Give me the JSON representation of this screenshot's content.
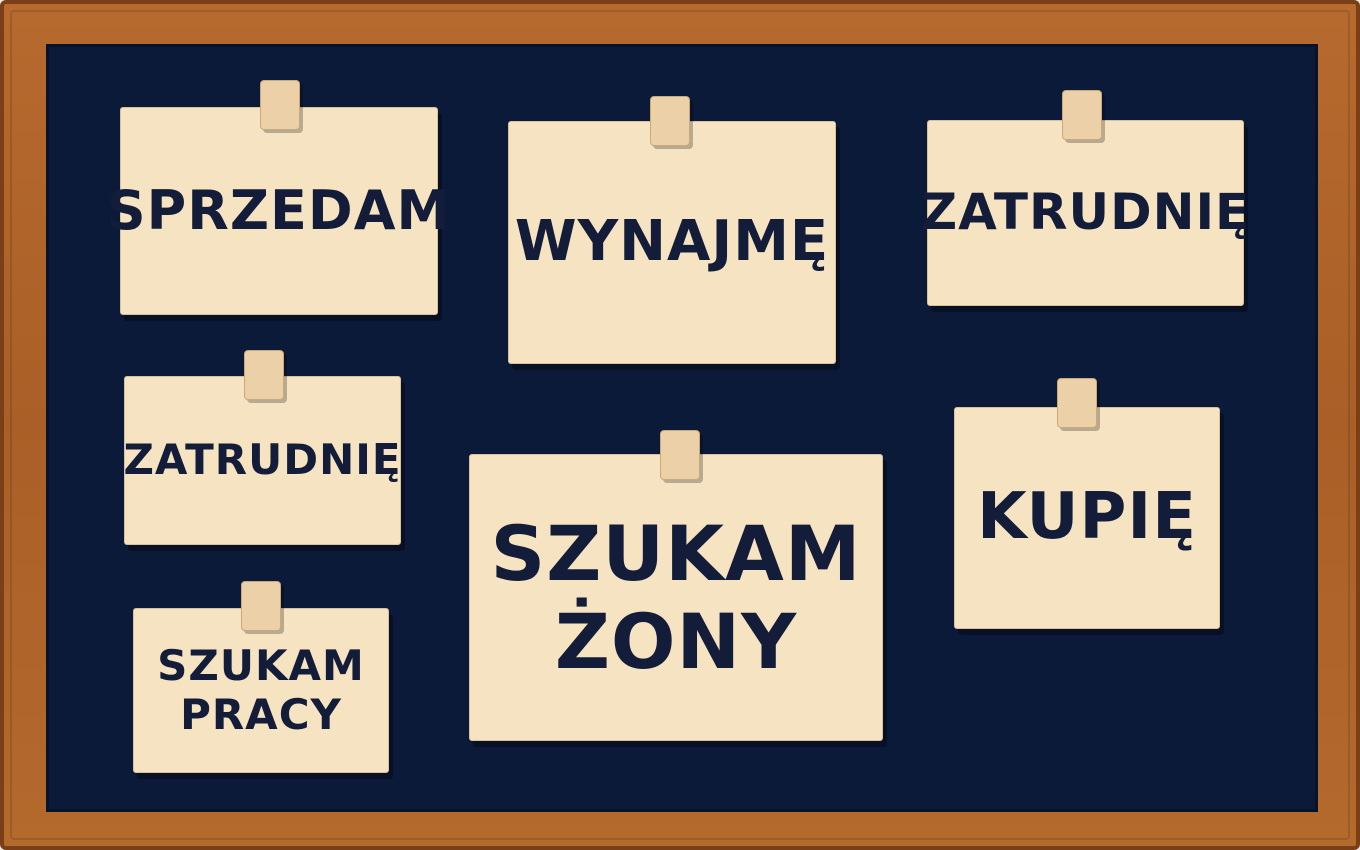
{
  "board": {
    "colors": {
      "frame": "#b06429",
      "surface": "#0c1a3a",
      "note": "#f5e3c2",
      "text": "#131c38",
      "tape": "#ecd1a8"
    },
    "notes": [
      {
        "line1": "SPRZEDAM"
      },
      {
        "line1": "WYNAJMĘ"
      },
      {
        "line1": "ZATRUDNIĘ"
      },
      {
        "line1": "ZATRUDNIĘ"
      },
      {
        "line1": "SZUKAM",
        "line2": "ŻONY"
      },
      {
        "line1": "KUPIĘ"
      },
      {
        "line1": "SZUKAM",
        "line2": "PRACY"
      }
    ]
  }
}
